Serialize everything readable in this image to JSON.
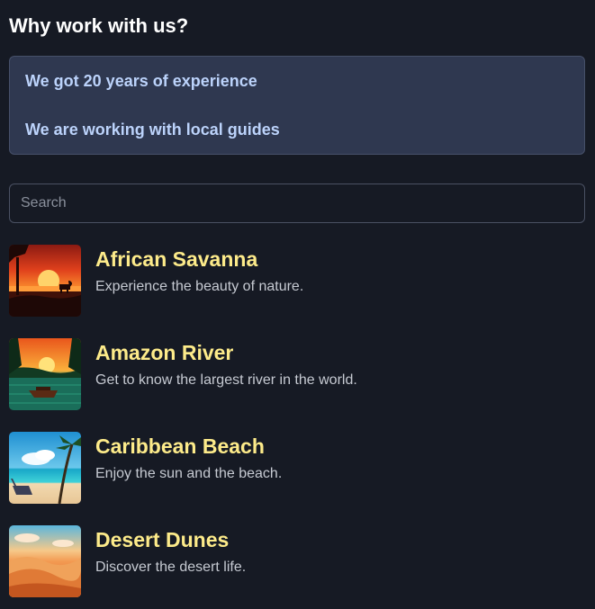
{
  "header": {
    "title": "Why work with us?"
  },
  "reasons": [
    {
      "label": "We got 20 years of experience"
    },
    {
      "label": "We are working with local guides"
    }
  ],
  "search": {
    "placeholder": "Search",
    "value": ""
  },
  "destinations": [
    {
      "title": "African Savanna",
      "description": "Experience the beauty of nature.",
      "image": "savanna-sunset-image"
    },
    {
      "title": "Amazon River",
      "description": "Get to know the largest river in the world.",
      "image": "river-boat-image"
    },
    {
      "title": "Caribbean Beach",
      "description": "Enjoy the sun and the beach.",
      "image": "beach-palm-image"
    },
    {
      "title": "Desert Dunes",
      "description": "Discover the desert life.",
      "image": "desert-dunes-image"
    }
  ]
}
